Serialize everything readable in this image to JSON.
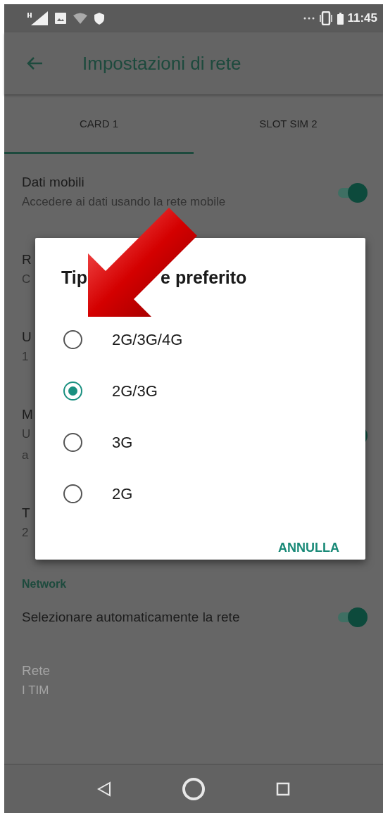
{
  "status_bar": {
    "time": "11:45"
  },
  "app_bar": {
    "title": "Impostazioni di rete"
  },
  "tabs": [
    {
      "label": "CARD 1",
      "selected": true
    },
    {
      "label": "SLOT SIM 2",
      "selected": false
    }
  ],
  "settings": [
    {
      "kind": "row",
      "title": "Dati mobili",
      "subtitle": "Accedere ai dati usando la rete mobile",
      "enabled": true,
      "switch": {
        "on": true
      }
    },
    {
      "kind": "row",
      "title": "R",
      "subtitle": "C",
      "enabled": true
    },
    {
      "kind": "row",
      "title": "U",
      "subtitle": "1",
      "enabled": true
    },
    {
      "kind": "row",
      "title": "M",
      "subtitle": "U\na",
      "enabled": true,
      "switch": {
        "on": true
      }
    },
    {
      "kind": "row",
      "title": "T",
      "subtitle": "2",
      "enabled": true
    },
    {
      "kind": "header",
      "title": "Network"
    },
    {
      "kind": "row",
      "title": "Selezionare automaticamente la rete",
      "enabled": true,
      "switch": {
        "on": true
      }
    },
    {
      "kind": "row",
      "title": "Rete",
      "subtitle": "I TIM",
      "enabled": false
    }
  ],
  "dialog": {
    "title_parts": [
      "Tip",
      "e preferito"
    ],
    "options": [
      {
        "label": "2G/3G/4G",
        "selected": false
      },
      {
        "label": "2G/3G",
        "selected": true
      },
      {
        "label": "3G",
        "selected": false
      },
      {
        "label": "2G",
        "selected": false
      }
    ],
    "cancel": "ANNULLA"
  }
}
